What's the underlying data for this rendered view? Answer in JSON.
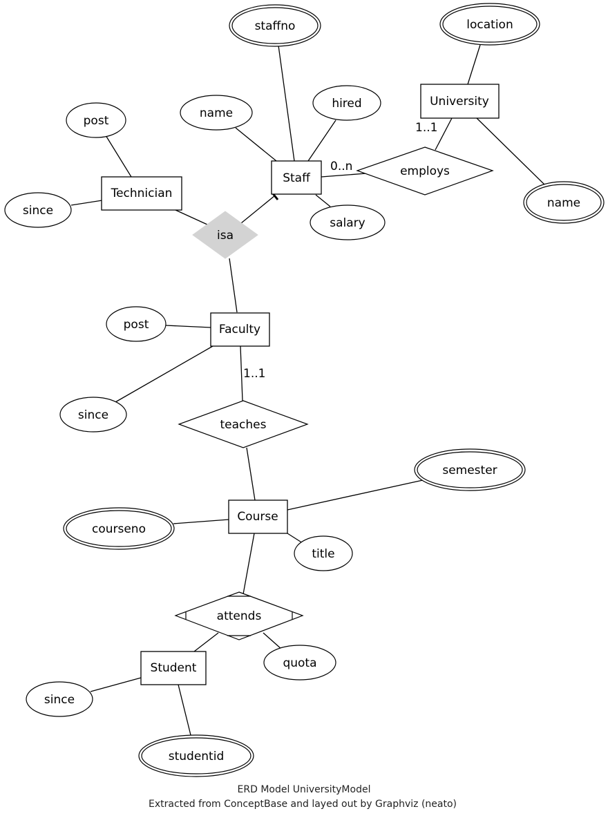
{
  "diagram": {
    "type": "ER diagram",
    "entities": [
      {
        "id": "staff",
        "label": "Staff"
      },
      {
        "id": "university",
        "label": "University"
      },
      {
        "id": "technician",
        "label": "Technician"
      },
      {
        "id": "faculty",
        "label": "Faculty"
      },
      {
        "id": "course",
        "label": "Course"
      },
      {
        "id": "student",
        "label": "Student"
      }
    ],
    "relationships": [
      {
        "id": "isa",
        "label": "isa",
        "style": "filled-gray"
      },
      {
        "id": "employs",
        "label": "employs"
      },
      {
        "id": "teaches",
        "label": "teaches"
      },
      {
        "id": "attends",
        "label": "attends",
        "style": "aggregate"
      }
    ],
    "attributes": [
      {
        "id": "staffno",
        "label": "staffno",
        "key": true
      },
      {
        "id": "location",
        "label": "location",
        "key": true
      },
      {
        "id": "staff_name",
        "label": "name",
        "key": false
      },
      {
        "id": "hired",
        "label": "hired",
        "key": false
      },
      {
        "id": "salary",
        "label": "salary",
        "key": false
      },
      {
        "id": "uni_name",
        "label": "name",
        "key": true
      },
      {
        "id": "tech_post",
        "label": "post",
        "key": false
      },
      {
        "id": "tech_since",
        "label": "since",
        "key": false
      },
      {
        "id": "fac_post",
        "label": "post",
        "key": false
      },
      {
        "id": "fac_since",
        "label": "since",
        "key": false
      },
      {
        "id": "semester",
        "label": "semester",
        "key": true
      },
      {
        "id": "courseno",
        "label": "courseno",
        "key": true
      },
      {
        "id": "title",
        "label": "title",
        "key": false
      },
      {
        "id": "quota",
        "label": "quota",
        "key": false
      },
      {
        "id": "stu_since",
        "label": "since",
        "key": false
      },
      {
        "id": "studentid",
        "label": "studentid",
        "key": true
      }
    ],
    "edge_labels": {
      "staff_employs": "0..n",
      "university_employs": "1..1",
      "faculty_teaches": "1..1"
    },
    "caption": {
      "line1": "ERD Model UniversityModel",
      "line2": "Extracted from ConceptBase and layed out by Graphviz (neato)"
    }
  }
}
